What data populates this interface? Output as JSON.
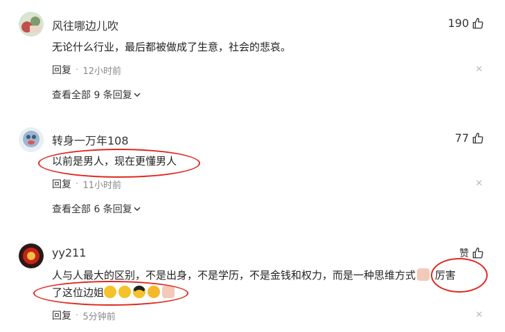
{
  "comments": [
    {
      "username": "风往哪边儿吹",
      "likes": "190",
      "text": "无论什么行业，最后都被做成了生意，社会的悲哀。",
      "reply_label": "回复",
      "time": "12小时前",
      "view_all": "查看全部 9 条回复"
    },
    {
      "username": "转身一万年108",
      "likes": "77",
      "text": "以前是男人，现在更懂男人",
      "reply_label": "回复",
      "time": "11小时前",
      "view_all": "查看全部 6 条回复"
    },
    {
      "username": "yy211",
      "likes": "赞",
      "text_line1": "人与人最大的区别，不是出身，不是学历，不是金钱和权力，而是一种思维方式",
      "text_line1_tail": " 厉害",
      "text_line2": "了这位边姐",
      "reply_label": "回复",
      "time": "5分钟前"
    }
  ],
  "icons": {
    "like": "thumbs-up-icon",
    "close": "close-icon",
    "chevron": "chevron-down-icon"
  },
  "colors": {
    "highlight": "#e0271f",
    "muted": "#888888"
  }
}
